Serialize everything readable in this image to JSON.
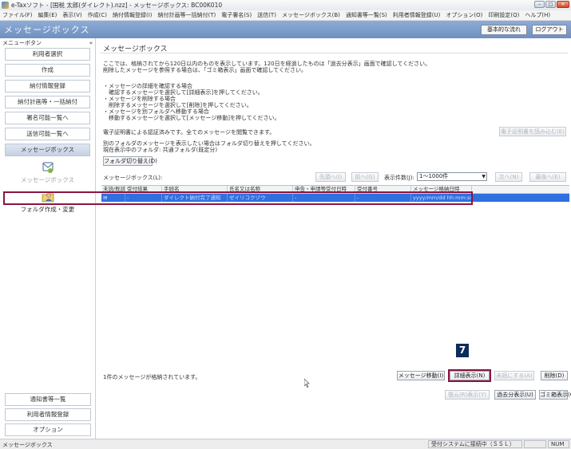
{
  "window": {
    "title": "e-Taxソフト - [国税 太郎(ダイレクト).nzz] - メッセージボックス: BC00K010",
    "controls": {
      "minimize": "–",
      "maximize": "□",
      "close": "✕"
    }
  },
  "menubar": [
    "ファイル(F)",
    "編集(E)",
    "表示(V)",
    "作成(C)",
    "納付情報登録(I)",
    "納付計画等一括納付(T)",
    "電子署名(S)",
    "送信(T)",
    "メッセージボックス(B)",
    "通知書等一覧(S)",
    "利用者情報登録(U)",
    "オプション(O)",
    "印刷設定(Q)",
    "ヘルプ(H)"
  ],
  "header": {
    "title": "メッセージボックス",
    "basic_button": "基本的な流れ",
    "logout_button": "ログアウト"
  },
  "sidebar": {
    "menu_label": "メニューボタン",
    "collapse": "«",
    "buttons": [
      "利用者選択",
      "作成",
      "納付情報登録",
      "納付計画等・一括納付",
      "署名可能一覧へ",
      "送信可能一覧へ",
      "メッセージボックス"
    ],
    "icon_items": [
      {
        "label": "メッセージボックス",
        "icon": "message-box-icon"
      },
      {
        "label": "フォルダ作成・変更",
        "icon": "folder-user-icon"
      }
    ],
    "bottom_buttons": [
      "通知書等一覧",
      "利用者情報登録",
      "オプション"
    ]
  },
  "main": {
    "title": "メッセージボックス",
    "info_lines": [
      "ここでは、格納されてから120日以内のものを表示しています。120日を経過したものは「過去分表示」画面で確認してください。",
      "削除したメッセージを参照する場合は、「ゴミ箱表示」画面で確認してください。",
      "",
      "・メッセージの詳細を確認する場合",
      "　確認するメッセージを選択して[詳細表示]を押してください。",
      "・メッセージを削除する場合",
      "　削除するメッセージを選択して[削除]を押してください。",
      "・メッセージを別フォルダへ移動する場合",
      "　移動するメッセージを選択して[メッセージ移動]を押してください。"
    ],
    "cert_line": "電子証明書による認証済みです。全てのメッセージを閲覧できます。",
    "cert_button": "電子証明書を読み込む(E)",
    "folder_lines": [
      "別のフォルダのメッセージを表示したい場合はフォルダ切り替えを押してください。",
      "現在表示中のフォルダ: 共通フォルダ(既定分)"
    ],
    "folder_switch_button": "フォルダ切り替え(D)",
    "list_label": "メッセージボックス(L):",
    "nav_first": "先頭へ(I)",
    "nav_prev": "前へ(G)",
    "display_count_label": "表示件数(J):",
    "display_count_value": "1〜1000件",
    "nav_next": "次へ(N)",
    "nav_last": "最後へ(E)",
    "columns": [
      "未読/既読",
      "受付結果",
      "手続名",
      "氏名又は名称",
      "申告・申請等受付日時",
      "受付番号",
      "メッセージ格納日時"
    ],
    "rows": [
      {
        "status": "✉",
        "result": "-",
        "procedure": "ダイレクト納付完了通知",
        "name": "ゼイリコクゾウ",
        "received_at": "-",
        "receipt_no": "-",
        "stored_at": "yyyy/mm/dd hh:mm:ss"
      }
    ],
    "message_count": "1件のメッセージが格納されています。",
    "buttons": {
      "move": "メッセージ移動(I)",
      "detail": "詳細表示(N)",
      "mark_unread": "未読にする(A)",
      "delete": "削除(D)",
      "restore": "復元(R)表示(Y)",
      "past": "過去分表示(U)",
      "trash": "ゴミ箱表示(Q)"
    },
    "step_badge": "7"
  },
  "statusbar": {
    "left": "メッセージボックス",
    "connection": "受付システムに接続中（ＳＳＬ）",
    "num": "NUM"
  }
}
